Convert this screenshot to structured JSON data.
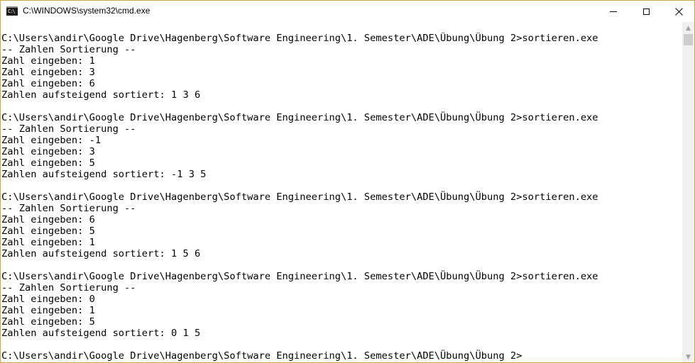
{
  "window": {
    "title": "C:\\WINDOWS\\system32\\cmd.exe",
    "icon": "cmd-icon",
    "icon_glyph": "C:\\",
    "controls": [
      "minimize-icon",
      "maximize-icon",
      "close-icon"
    ],
    "close_glyph": "✕"
  },
  "console": {
    "lines": [
      "C:\\Users\\andir\\Google Drive\\Hagenberg\\Software Engineering\\1. Semester\\ADE\\Übung\\Übung 2>sortieren.exe",
      "-- Zahlen Sortierung --",
      "Zahl eingeben: 1",
      "Zahl eingeben: 3",
      "Zahl eingeben: 6",
      "Zahlen aufsteigend sortiert: 1 3 6",
      "",
      "C:\\Users\\andir\\Google Drive\\Hagenberg\\Software Engineering\\1. Semester\\ADE\\Übung\\Übung 2>sortieren.exe",
      "-- Zahlen Sortierung --",
      "Zahl eingeben: -1",
      "Zahl eingeben: 3",
      "Zahl eingeben: 5",
      "Zahlen aufsteigend sortiert: -1 3 5",
      "",
      "C:\\Users\\andir\\Google Drive\\Hagenberg\\Software Engineering\\1. Semester\\ADE\\Übung\\Übung 2>sortieren.exe",
      "-- Zahlen Sortierung --",
      "Zahl eingeben: 6",
      "Zahl eingeben: 5",
      "Zahl eingeben: 1",
      "Zahlen aufsteigend sortiert: 1 5 6",
      "",
      "C:\\Users\\andir\\Google Drive\\Hagenberg\\Software Engineering\\1. Semester\\ADE\\Übung\\Übung 2>sortieren.exe",
      "-- Zahlen Sortierung --",
      "Zahl eingeben: 0",
      "Zahl eingeben: 1",
      "Zahl eingeben: 5",
      "Zahlen aufsteigend sortiert: 0 1 5",
      "",
      "C:\\Users\\andir\\Google Drive\\Hagenberg\\Software Engineering\\1. Semester\\ADE\\Übung\\Übung 2>"
    ]
  },
  "scrollbar": {
    "up_glyph": "▲",
    "down_glyph": "▼"
  },
  "colors": {
    "console_background": "#ffffff",
    "console_text": "#000000",
    "window_border": "#c8a94a"
  }
}
